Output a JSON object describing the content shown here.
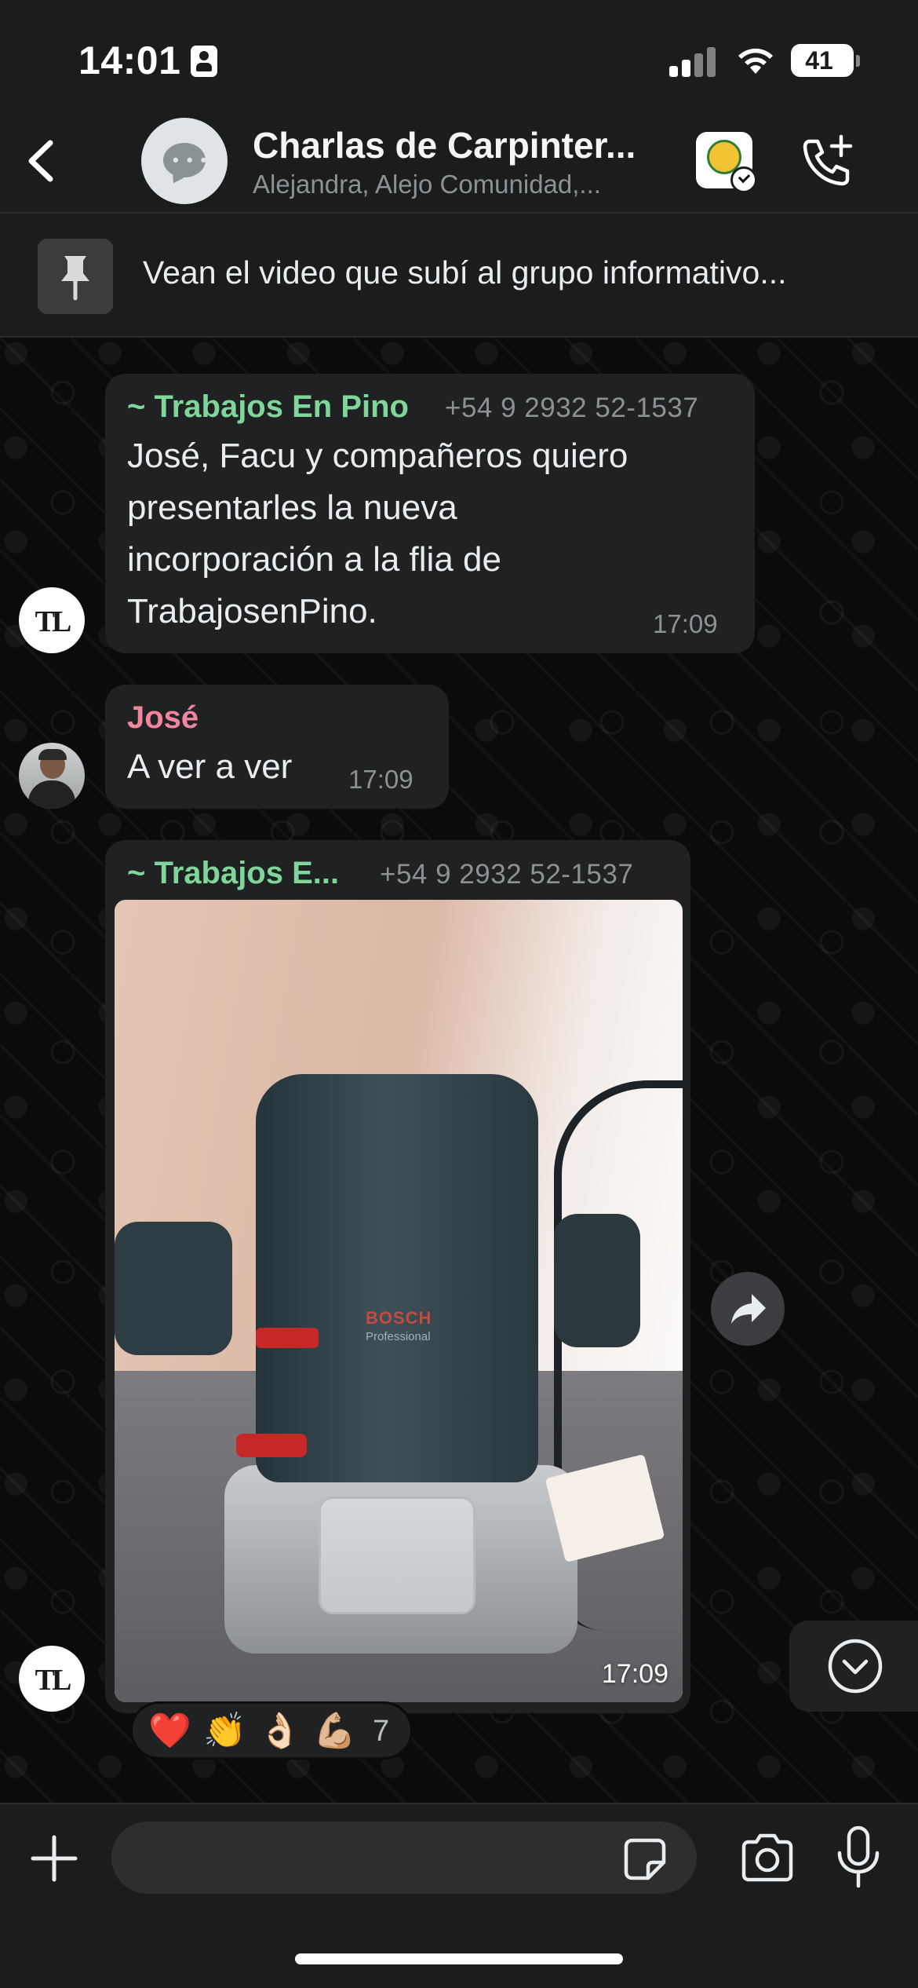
{
  "status_bar": {
    "time": "14:01",
    "battery": "41"
  },
  "header": {
    "title": "Charlas de Carpinter...",
    "subtitle": "Alejandra, Alejo Comunidad,..."
  },
  "pinned": {
    "text": "Vean el video que subí al grupo informativo..."
  },
  "messages": [
    {
      "sender": "~ Trabajos En Pino",
      "phone": "+54 9 2932 52-1537",
      "lines": [
        "José, Facu y compañeros quiero",
        "presentarles la nueva",
        "incorporación a la flia de",
        "TrabajosenPino."
      ],
      "time": "17:09",
      "avatar": "TL"
    },
    {
      "sender": "José",
      "text": "A ver a ver",
      "time": "17:09"
    },
    {
      "sender": "~ Trabajos E...",
      "phone": "+54 9 2932 52-1537",
      "video_time": "17:09",
      "video_brand": "BOSCH",
      "video_brand_sub": "Professional",
      "avatar": "TL"
    }
  ],
  "reactions": {
    "emojis": [
      "❤️",
      "👏",
      "👌🏻",
      "💪🏼"
    ],
    "count": "7"
  },
  "composer": {
    "placeholder": ""
  },
  "colors": {
    "sender_green": "#7fd59a",
    "sender_pink": "#f2849e",
    "bubble": "#1f2123",
    "background": "#0b0b0c"
  },
  "icons": [
    "back-chevron-icon",
    "group-chat-icon",
    "add-call-icon",
    "pin-icon",
    "forward-icon",
    "chevron-down-icon",
    "plus-icon",
    "sticker-icon",
    "camera-icon",
    "microphone-icon"
  ]
}
